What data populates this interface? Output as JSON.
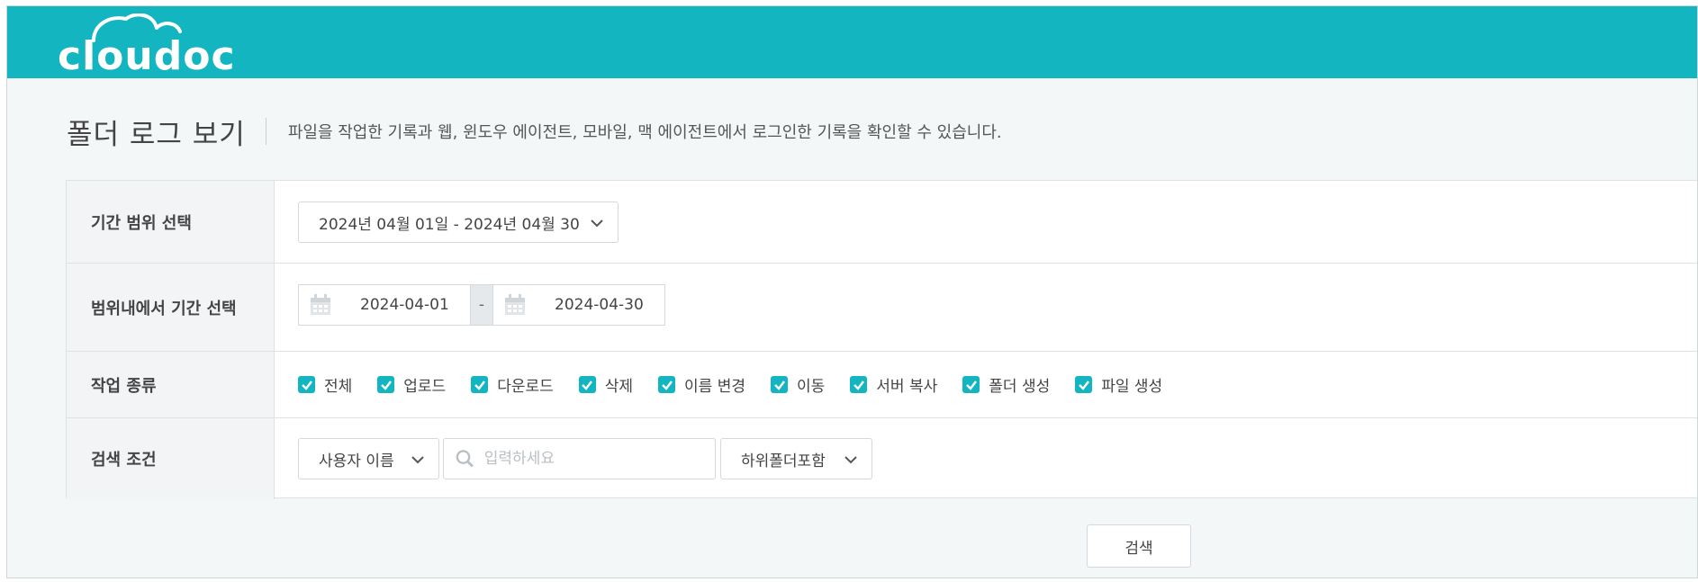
{
  "app": {
    "logo_text": "cloudoc"
  },
  "page": {
    "title": "폴더 로그 보기",
    "description": "파일을 작업한 기록과 웹, 윈도우 에이전트, 모바일, 맥 에이전트에서 로그인한 기록을 확인할 수 있습니다."
  },
  "form": {
    "period_range": {
      "label": "기간 범위 선택",
      "selected": "2024년 04월 01일 - 2024년 04월 30일"
    },
    "period_within": {
      "label": "범위내에서 기간 선택",
      "start_date": "2024-04-01",
      "separator": "-",
      "end_date": "2024-04-30"
    },
    "work_type": {
      "label": "작업 종류",
      "options": [
        {
          "label": "전체",
          "checked": true
        },
        {
          "label": "업로드",
          "checked": true
        },
        {
          "label": "다운로드",
          "checked": true
        },
        {
          "label": "삭제",
          "checked": true
        },
        {
          "label": "이름 변경",
          "checked": true
        },
        {
          "label": "이동",
          "checked": true
        },
        {
          "label": "서버 복사",
          "checked": true
        },
        {
          "label": "폴더 생성",
          "checked": true
        },
        {
          "label": "파일 생성",
          "checked": true
        }
      ]
    },
    "search_condition": {
      "label": "검색 조건",
      "field_select": "사용자 이름",
      "input_placeholder": "입력하세요",
      "input_value": "",
      "scope_select": "하위폴더포함"
    }
  },
  "actions": {
    "search_label": "검색"
  },
  "colors": {
    "brand": "#12b5c0",
    "label_bg": "#f2f4f5",
    "page_bg": "#f4f7f8"
  }
}
